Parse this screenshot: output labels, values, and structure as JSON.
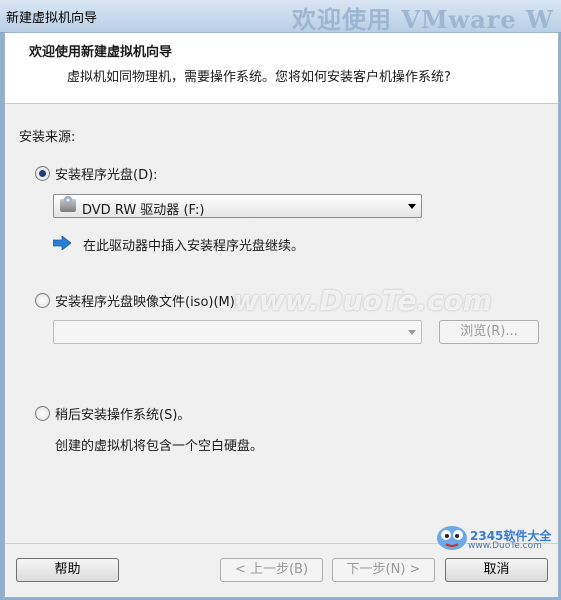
{
  "window": {
    "title": "新建虚拟机向导",
    "background_banner": "欢迎使用 VMware W"
  },
  "header": {
    "title": "欢迎使用新建虚拟机向导",
    "subtitle": "虚拟机如同物理机，需要操作系统。您将如何安装客户机操作系统?"
  },
  "install_source": {
    "label": "安装来源:",
    "option_disc": {
      "label": "安装程序光盘(D):",
      "selected": true,
      "drive_value": "DVD RW 驱动器 (F:)",
      "hint": "在此驱动器中插入安装程序光盘继续。"
    },
    "option_iso": {
      "label": "安装程序光盘映像文件(iso)(M):",
      "selected": false,
      "path_value": "",
      "browse_label": "浏览(R)..."
    },
    "option_later": {
      "label": "稍后安装操作系统(S)。",
      "selected": false,
      "note": "创建的虚拟机将包含一个空白硬盘。"
    }
  },
  "footer": {
    "help": "帮助",
    "back": "< 上一步(B)",
    "next": "下一步(N) >",
    "cancel": "取消"
  },
  "watermark": {
    "text": "www.DuoTe.com",
    "logo_name": "2345软件大全",
    "logo_url": "www.DuoTe.com"
  },
  "colors": {
    "accent_arrow": "#2a7fd6",
    "selected_radio": "#1c3f7a",
    "title_bar": "#c7d9ec"
  }
}
